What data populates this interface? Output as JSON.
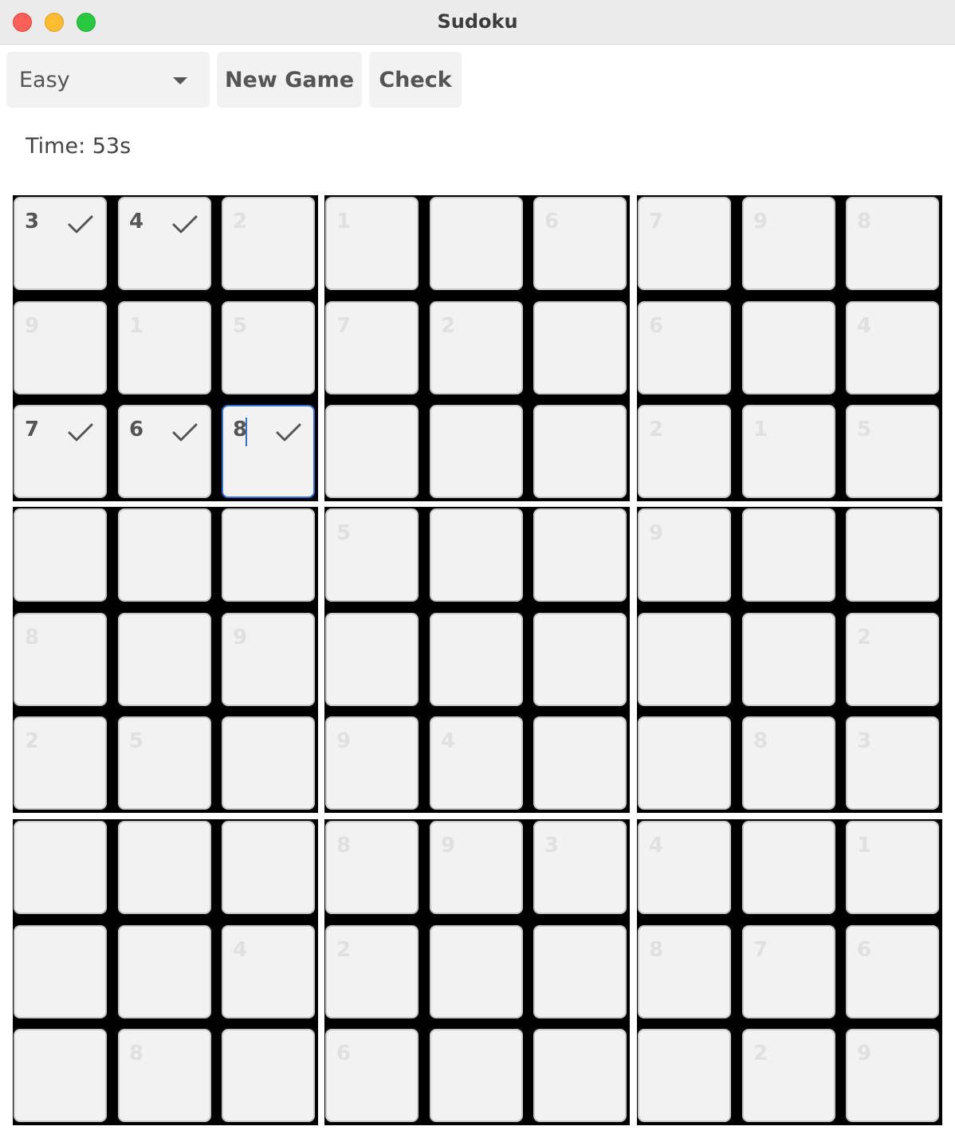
{
  "window": {
    "title": "Sudoku"
  },
  "toolbar": {
    "difficulty": "Easy",
    "new_game_label": "New Game",
    "check_label": "Check"
  },
  "timer": {
    "text": "Time: 53s"
  },
  "colors": {
    "accent": "#2f6fd6",
    "cell_bg": "#f2f2f2",
    "given_digit": "#e0e0e0",
    "entered_digit": "#555555",
    "box_border": "#000000"
  },
  "board": {
    "rows": [
      [
        "3",
        "4",
        "2",
        "1",
        "",
        "6",
        "7",
        "9",
        "8"
      ],
      [
        "9",
        "1",
        "5",
        "7",
        "2",
        "",
        "6",
        "",
        "4"
      ],
      [
        "7",
        "6",
        "8",
        "",
        "",
        "",
        "2",
        "1",
        "5"
      ],
      [
        "",
        "",
        "",
        "5",
        "",
        "",
        "9",
        "",
        ""
      ],
      [
        "8",
        "",
        "9",
        "",
        "",
        "",
        "",
        "",
        "2"
      ],
      [
        "2",
        "5",
        "",
        "9",
        "4",
        "",
        "",
        "8",
        "3"
      ],
      [
        "",
        "",
        "",
        "8",
        "9",
        "3",
        "4",
        "",
        "1"
      ],
      [
        "",
        "",
        "4",
        "2",
        "",
        "",
        "8",
        "7",
        "6"
      ],
      [
        "",
        "8",
        "",
        "6",
        "",
        "",
        "",
        "2",
        "9"
      ]
    ],
    "entered": [
      [
        0,
        0
      ],
      [
        0,
        1
      ],
      [
        2,
        0
      ],
      [
        2,
        1
      ],
      [
        2,
        2
      ]
    ],
    "selected": [
      2,
      2
    ]
  }
}
